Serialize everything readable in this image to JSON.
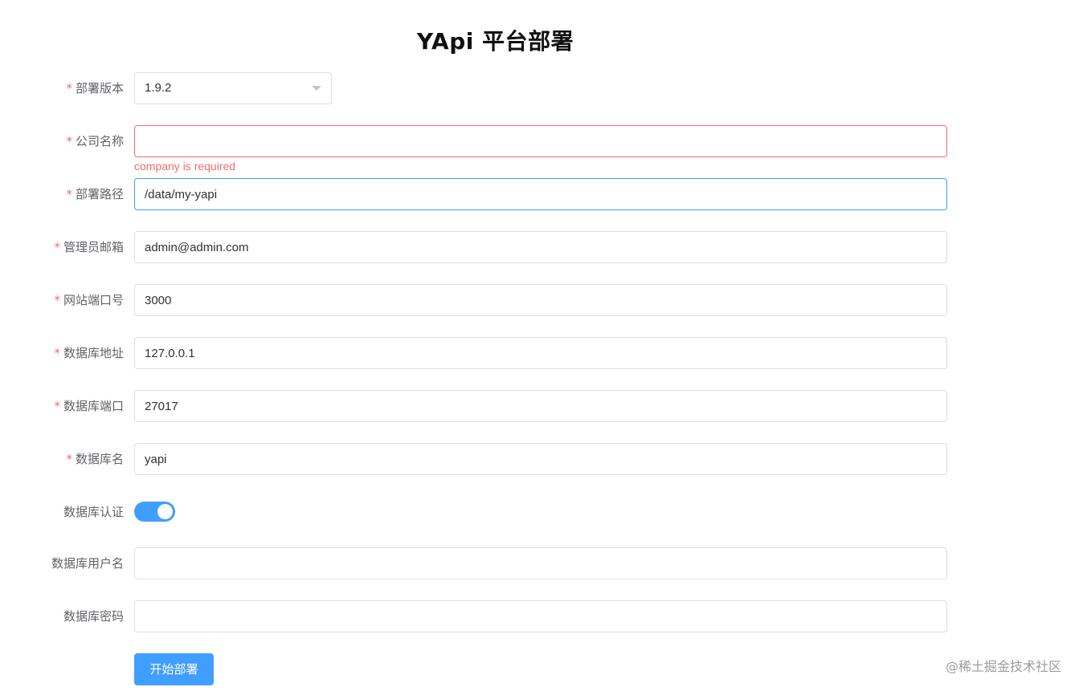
{
  "page": {
    "title": "YApi 平台部署"
  },
  "form": {
    "version": {
      "label": "部署版本",
      "required": "*",
      "value": "1.9.2"
    },
    "company": {
      "label": "公司名称",
      "required": "*",
      "value": "",
      "error": "company is required"
    },
    "root": {
      "label": "部署路径",
      "required": "*",
      "value": "/data/my-yapi"
    },
    "email": {
      "label": "管理员邮箱",
      "required": "*",
      "value": "admin@admin.com"
    },
    "port": {
      "label": "网站端口号",
      "required": "*",
      "value": "3000"
    },
    "db_server": {
      "label": "数据库地址",
      "required": "*",
      "value": "127.0.0.1"
    },
    "db_port": {
      "label": "数据库端口",
      "required": "*",
      "value": "27017"
    },
    "db_name": {
      "label": "数据库名",
      "required": "*",
      "value": "yapi"
    },
    "db_auth": {
      "label": "数据库认证",
      "enabled": true
    },
    "db_user": {
      "label": "数据库用户名",
      "value": ""
    },
    "db_pass": {
      "label": "数据库密码",
      "value": ""
    },
    "submit_label": "开始部署"
  },
  "watermark": "@稀土掘金技术社区",
  "colors": {
    "primary": "#409eff",
    "error": "#f56c6c",
    "label": "#606266",
    "border": "#dcdfe6"
  }
}
